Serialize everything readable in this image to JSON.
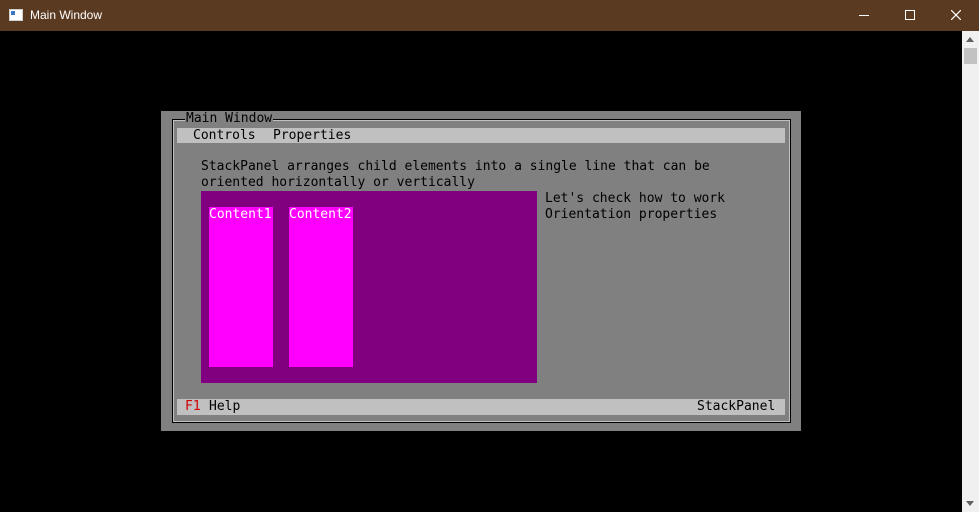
{
  "window": {
    "title": "Main Window"
  },
  "tui": {
    "frame_title": "Main Window",
    "menu": [
      "Controls",
      "Properties"
    ],
    "description": [
      "StackPanel arranges child elements into a single line that can be",
      "oriented horizontally or vertically"
    ],
    "contents": [
      "Content1",
      "Content2"
    ],
    "side_text": [
      "Let's check how to work",
      "Orientation properties"
    ],
    "status": {
      "key": "F1",
      "key_label": "Help",
      "right": "StackPanel"
    }
  },
  "colors": {
    "titlebar": "#5a3a20",
    "tui_background": "#808080",
    "bar": "#c0c0c0",
    "stackpanel": "#800080",
    "content": "#ff00ff",
    "hotkey": "#d00000"
  },
  "icons": {
    "app": "console-app-icon",
    "minimize": "minimize-icon",
    "maximize": "maximize-icon",
    "close": "close-icon"
  }
}
